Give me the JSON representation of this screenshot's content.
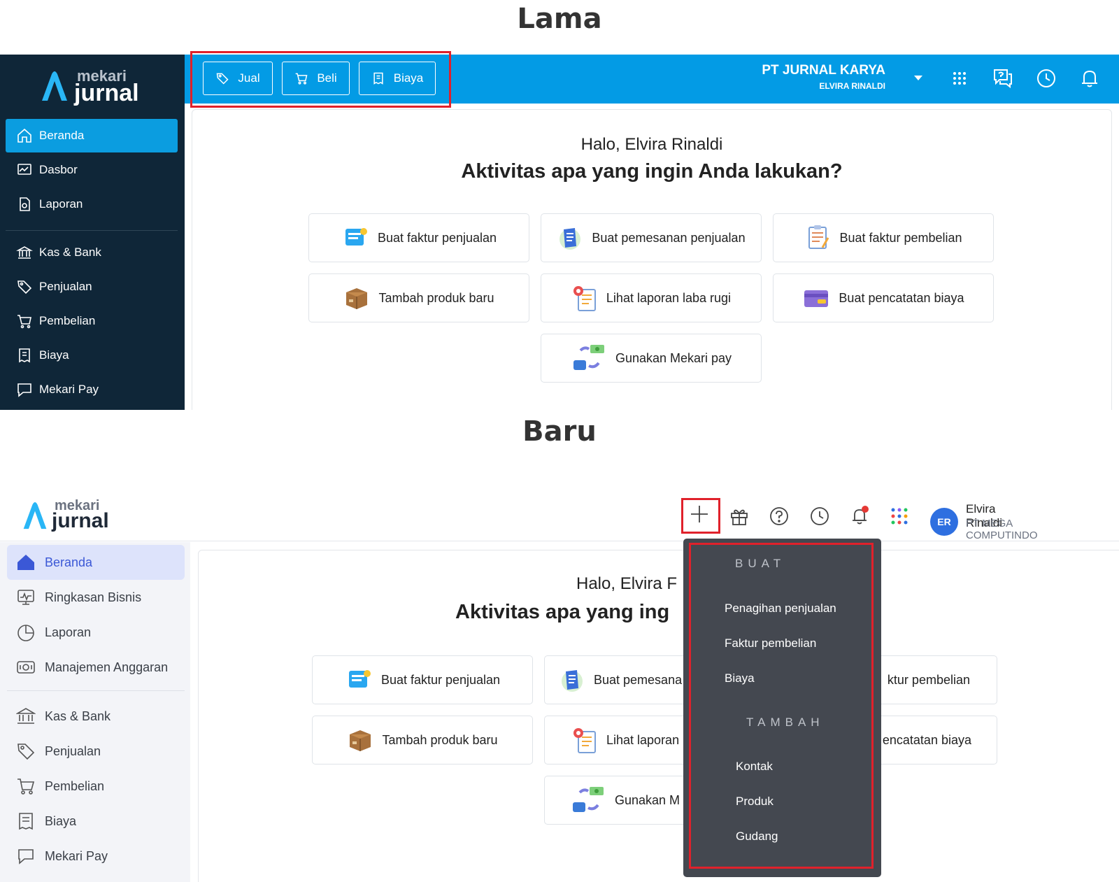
{
  "labels": {
    "old_title": "Lama",
    "new_title": "Baru"
  },
  "colors": {
    "old_sidebar": "#0f2638",
    "old_topbar": "#039be5",
    "highlight_red": "#e0212b",
    "new_active": "#dde3fb",
    "dropdown_bg": "#444850"
  },
  "old": {
    "logo": {
      "top": "mekari",
      "bottom": "jurnal"
    },
    "quick_buttons": [
      {
        "label": "Jual",
        "icon": "tag-icon"
      },
      {
        "label": "Beli",
        "icon": "cart-icon"
      },
      {
        "label": "Biaya",
        "icon": "receipt-icon"
      }
    ],
    "company": {
      "name": "PT JURNAL KARYA",
      "user": "ELVIRA RINALDI"
    },
    "sidebar": [
      {
        "label": "Beranda",
        "icon": "home-icon",
        "active": true
      },
      {
        "label": "Dasbor",
        "icon": "dashboard-icon"
      },
      {
        "label": "Laporan",
        "icon": "report-icon"
      },
      {
        "label": "Kas & Bank",
        "icon": "bank-icon"
      },
      {
        "label": "Penjualan",
        "icon": "tag-icon"
      },
      {
        "label": "Pembelian",
        "icon": "cart-icon"
      },
      {
        "label": "Biaya",
        "icon": "receipt-icon"
      },
      {
        "label": "Mekari Pay",
        "icon": "chat-icon"
      }
    ],
    "greeting": "Halo, Elvira Rinaldi",
    "question": "Aktivitas apa yang ingin Anda lakukan?",
    "cards": [
      "Buat faktur penjualan",
      "Buat pemesanan penjualan",
      "Buat faktur pembelian",
      "Tambah produk baru",
      "Lihat laporan laba rugi",
      "Buat pencatatan biaya",
      "Gunakan Mekari pay"
    ]
  },
  "new": {
    "logo": {
      "top": "mekari",
      "bottom": "jurnal"
    },
    "user": {
      "initials": "ER",
      "name": "Elvira Rinaldi",
      "company": "PT MEGA COMPUTINDO"
    },
    "sidebar": [
      {
        "label": "Beranda",
        "icon": "home-icon",
        "active": true
      },
      {
        "label": "Ringkasan Bisnis",
        "icon": "dashboard-icon"
      },
      {
        "label": "Laporan",
        "icon": "pie-chart-icon"
      },
      {
        "label": "Manajemen Anggaran",
        "icon": "budget-icon"
      },
      {
        "label": "Kas & Bank",
        "icon": "bank-icon"
      },
      {
        "label": "Penjualan",
        "icon": "tag-icon"
      },
      {
        "label": "Pembelian",
        "icon": "cart-icon"
      },
      {
        "label": "Biaya",
        "icon": "receipt-icon"
      },
      {
        "label": "Mekari Pay",
        "icon": "chat-icon"
      }
    ],
    "greeting": "Halo, Elvira F",
    "question": "Aktivitas apa yang ing",
    "cards": [
      "Buat faktur penjualan",
      "Buat pemesana",
      "ktur pembelian",
      "Tambah produk baru",
      "Lihat laporan",
      "encatatan biaya",
      "Gunakan M"
    ],
    "dropdown": {
      "section_create": "BUAT",
      "create_items": [
        "Penagihan penjualan",
        "Faktur pembelian",
        "Biaya"
      ],
      "section_add": "TAMBAH",
      "add_items": [
        "Kontak",
        "Produk",
        "Gudang"
      ]
    }
  }
}
